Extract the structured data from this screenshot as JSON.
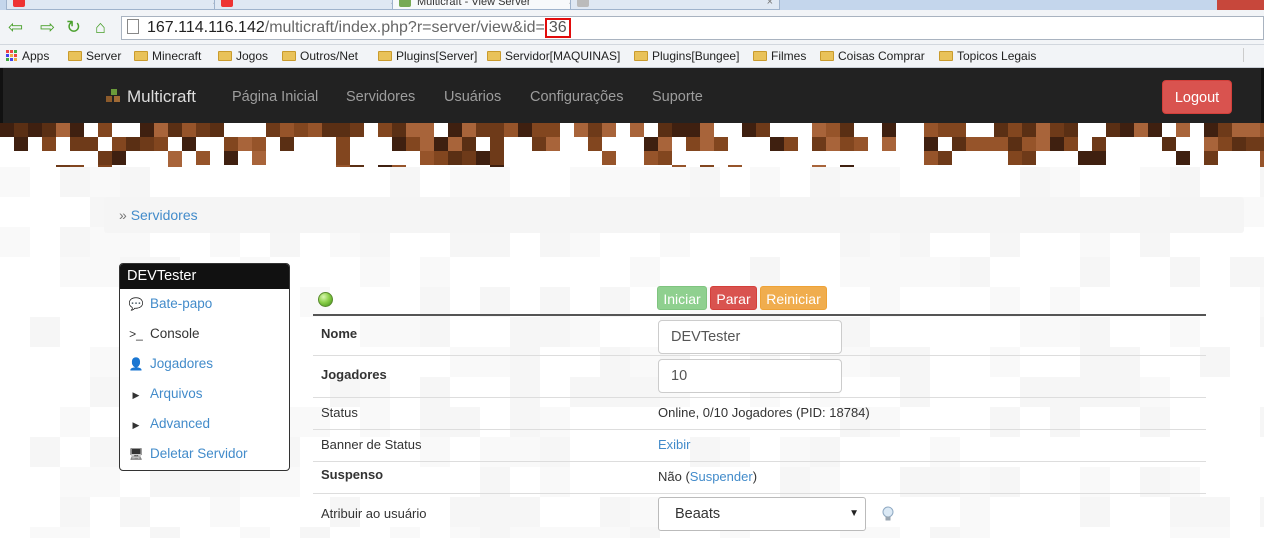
{
  "browser": {
    "tabs": [
      {
        "title": "",
        "active": false
      },
      {
        "title": "",
        "active": false
      },
      {
        "title": "Multicraft - View Server",
        "active": true
      },
      {
        "title": "",
        "active": false
      }
    ],
    "url": {
      "host": "167.114.116.142",
      "path": "/multicraft/index.php?r=server/view&id=",
      "id": "36"
    },
    "bookmarks": [
      "Apps",
      "Server",
      "Minecraft",
      "Jogos",
      "Outros/Net",
      "Plugins[Server]",
      "Servidor[MAQUINAS]",
      "Plugins[Bungee]",
      "Filmes",
      "Coisas Comprar",
      "Topicos Legais"
    ]
  },
  "navbar": {
    "brand": "Multicraft",
    "links": [
      "Página Inicial",
      "Servidores",
      "Usuários",
      "Configurações",
      "Suporte"
    ],
    "logout": "Logout"
  },
  "breadcrumb": {
    "separator": "»",
    "item": "Servidores"
  },
  "sidebar": {
    "title": "DEVTester",
    "items": [
      {
        "label": "Bate-papo",
        "icon": "chat-bubble-icon",
        "glyph": "💬",
        "link": true
      },
      {
        "label": "Console",
        "icon": "terminal-icon",
        "glyph": ">_",
        "link": false
      },
      {
        "label": "Jogadores",
        "icon": "user-icon",
        "glyph": "👤",
        "link": true
      },
      {
        "label": "Arquivos",
        "icon": "triangle-right-icon",
        "glyph": "▶",
        "link": true
      },
      {
        "label": "Advanced",
        "icon": "triangle-right-icon",
        "glyph": "▶",
        "link": true
      },
      {
        "label": "Deletar Servidor",
        "icon": "monitor-delete-icon",
        "glyph": "🖥",
        "link": true
      }
    ]
  },
  "controls": {
    "start": "Iniciar",
    "stop": "Parar",
    "restart": "Reiniciar"
  },
  "details": {
    "name_label": "Nome",
    "name_value": "DEVTester",
    "players_label": "Jogadores",
    "players_value": "10",
    "status_label": "Status",
    "status_value": "Online, 0/10 Jogadores (PID: 18784)",
    "banner_label": "Banner de Status",
    "banner_link": "Exibir",
    "suspended_label": "Suspenso",
    "suspended_value": "Não (",
    "suspended_link": "Suspender",
    "suspended_close": ")",
    "assign_label": "Atribuir ao usuário",
    "assign_value": "Beaats"
  },
  "colors": {
    "navbar_bg": "#222222",
    "logout_bg": "#d9534f",
    "start_bg": "#8fd08f",
    "stop_bg": "#d9534f",
    "restart_bg": "#f0ad4e",
    "link": "#428bca",
    "url_highlight": "#e10c0c"
  }
}
